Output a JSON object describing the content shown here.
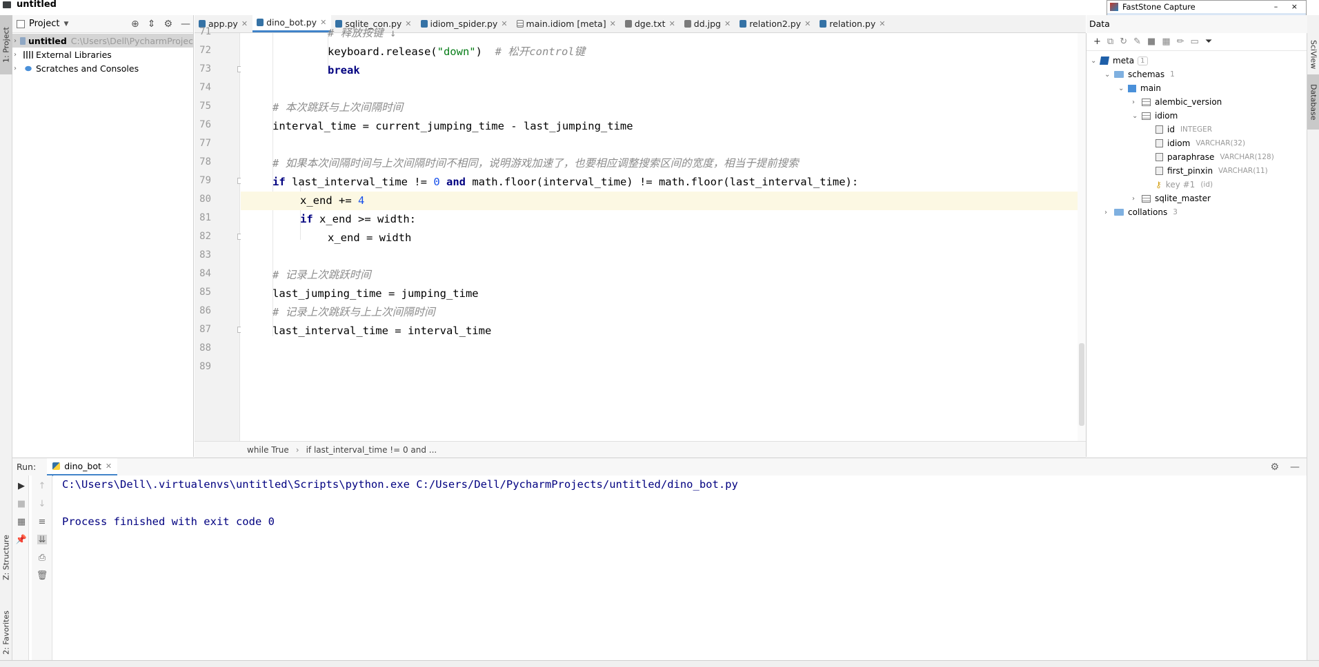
{
  "window": {
    "title": "untitled"
  },
  "left_strip": {
    "project_tab": "1: Project",
    "structure_tab": "Z: Structure",
    "favorites_tab": "2: Favorites"
  },
  "right_strip": {
    "sciview_tab": "SciView",
    "database_tab": "Database"
  },
  "project": {
    "header_label": "Project",
    "tree": [
      {
        "label": "untitled",
        "path": "C:\\Users\\Dell\\PycharmProjec"
      },
      {
        "label": "External Libraries"
      },
      {
        "label": "Scratches and Consoles"
      }
    ]
  },
  "tabs": [
    {
      "label": "app.py",
      "color": "#3572a5"
    },
    {
      "label": "dino_bot.py",
      "color": "#3572a5",
      "active": true
    },
    {
      "label": "sqlite_con.py",
      "color": "#3572a5"
    },
    {
      "label": "idiom_spider.py",
      "color": "#3572a5"
    },
    {
      "label": "main.idiom [meta]",
      "color": "#7a7a7a"
    },
    {
      "label": "dge.txt",
      "color": "#7a7a7a"
    },
    {
      "label": "dd.jpg",
      "color": "#7a7a7a"
    },
    {
      "label": "relation2.py",
      "color": "#3572a5"
    },
    {
      "label": "relation.py",
      "color": "#3572a5"
    }
  ],
  "editor": {
    "line_numbers": [
      "71",
      "72",
      "73",
      "74",
      "75",
      "76",
      "77",
      "78",
      "79",
      "80",
      "81",
      "82",
      "83",
      "84",
      "85",
      "86",
      "87",
      "88",
      "89"
    ],
    "current_line": "80",
    "code": {
      "l71_comment": "# 释放按键 ↓",
      "l72_a": "keyboard.release(",
      "l72_str": "\"down\"",
      "l72_b": ")  ",
      "l72_comment": "# 松开control键",
      "l73_kw": "break",
      "l75_comment": "# 本次跳跃与上次间隔时间",
      "l76": "interval_time = current_jumping_time - last_jumping_time",
      "l78_comment": "# 如果本次间隔时间与上次间隔时间不相同，说明游戏加速了，也要相应调整搜索区间的宽度，相当于提前搜索",
      "l79_kw_if": "if",
      "l79_a": " last_interval_time != ",
      "l79_num": "0",
      "l79_kw_and": " and",
      "l79_b": " math.floor(interval_time) != math.floor(last_interval_time):",
      "l80_a": "x_end += ",
      "l80_num": "4",
      "l81_kw": "if",
      "l81_a": " x_end >= width:",
      "l82": "x_end = width",
      "l84_comment": "# 记录上次跳跃时间",
      "l85": "last_jumping_time = jumping_time",
      "l86_comment": "# 记录上次跳跃与上上次间隔时间",
      "l87": "last_interval_time = interval_time"
    },
    "breadcrumb": [
      "while True",
      "if last_interval_time != 0 and ..."
    ]
  },
  "database": {
    "header_label": "Data",
    "tree": {
      "meta": {
        "label": "meta",
        "count": "1"
      },
      "schemas": {
        "label": "schemas",
        "count": "1"
      },
      "main": {
        "label": "main"
      },
      "alembic_version": {
        "label": "alembic_version"
      },
      "idiom_table": {
        "label": "idiom"
      },
      "columns": [
        {
          "name": "id",
          "type": "INTEGER"
        },
        {
          "name": "idiom",
          "type": "VARCHAR(32)"
        },
        {
          "name": "paraphrase",
          "type": "VARCHAR(128)"
        },
        {
          "name": "first_pinxin",
          "type": "VARCHAR(11)"
        }
      ],
      "key": {
        "name": "key #1",
        "type": "(id)"
      },
      "sqlite_master": {
        "label": "sqlite_master"
      },
      "collations": {
        "label": "collations",
        "count": "3"
      }
    }
  },
  "faststone": {
    "title": "FastStone Capture",
    "controls": "– ×"
  },
  "run": {
    "label": "Run:",
    "tab_label": "dino_bot",
    "console": [
      "C:\\Users\\Dell\\.virtualenvs\\untitled\\Scripts\\python.exe C:/Users/Dell/PycharmProjects/untitled/dino_bot.py",
      "",
      "Process finished with exit code 0"
    ]
  }
}
